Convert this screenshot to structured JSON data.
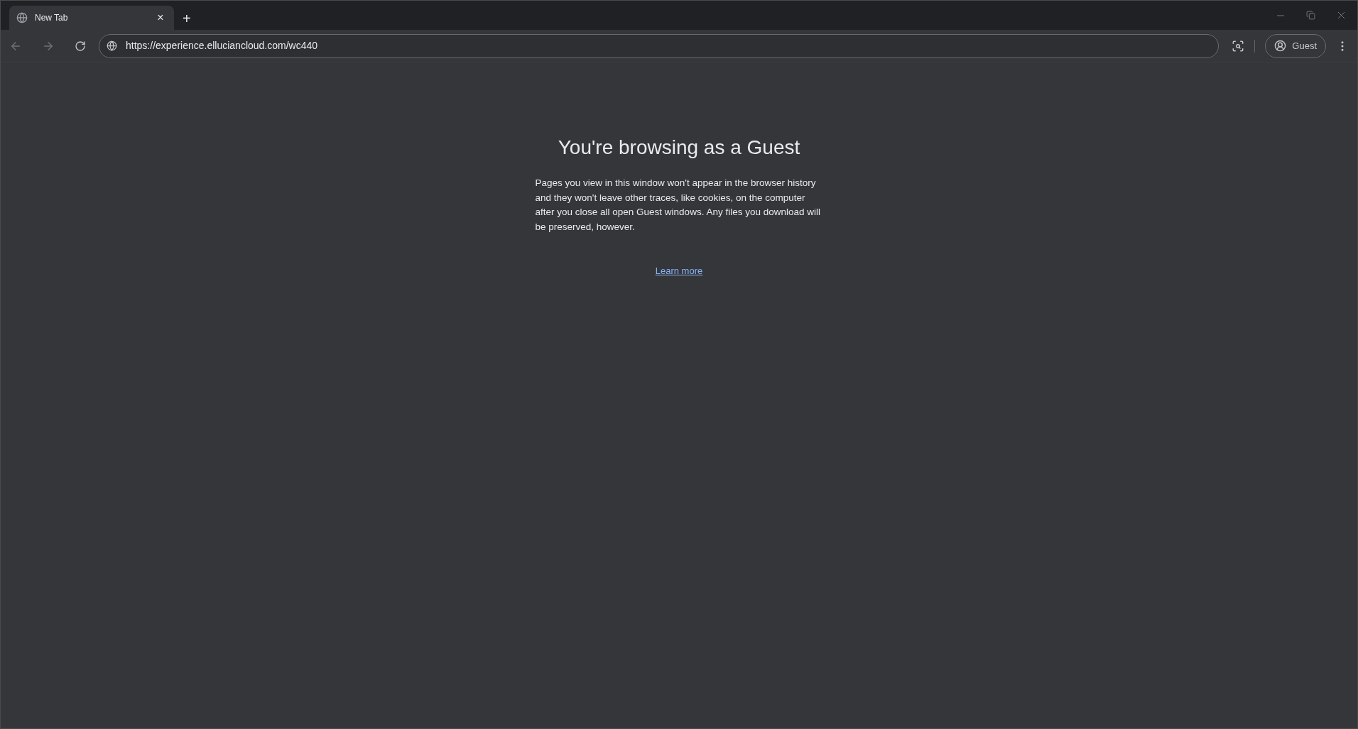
{
  "tabs": [
    {
      "title": "New Tab",
      "close": "×",
      "selected": true
    }
  ],
  "new_tab": "+",
  "toolbar": {
    "back_disabled": true,
    "forward_disabled": true,
    "address": "https://experience.elluciancloud.com/wc440",
    "profile": "Guest"
  },
  "page": {
    "heading": "You're browsing as a Guest",
    "body": "Pages you view in this window won't appear in the browser history and they won't leave other traces, like cookies, on the computer after you close all open Guest windows. Any files you download will be preserved, however.",
    "link": "Learn more"
  }
}
